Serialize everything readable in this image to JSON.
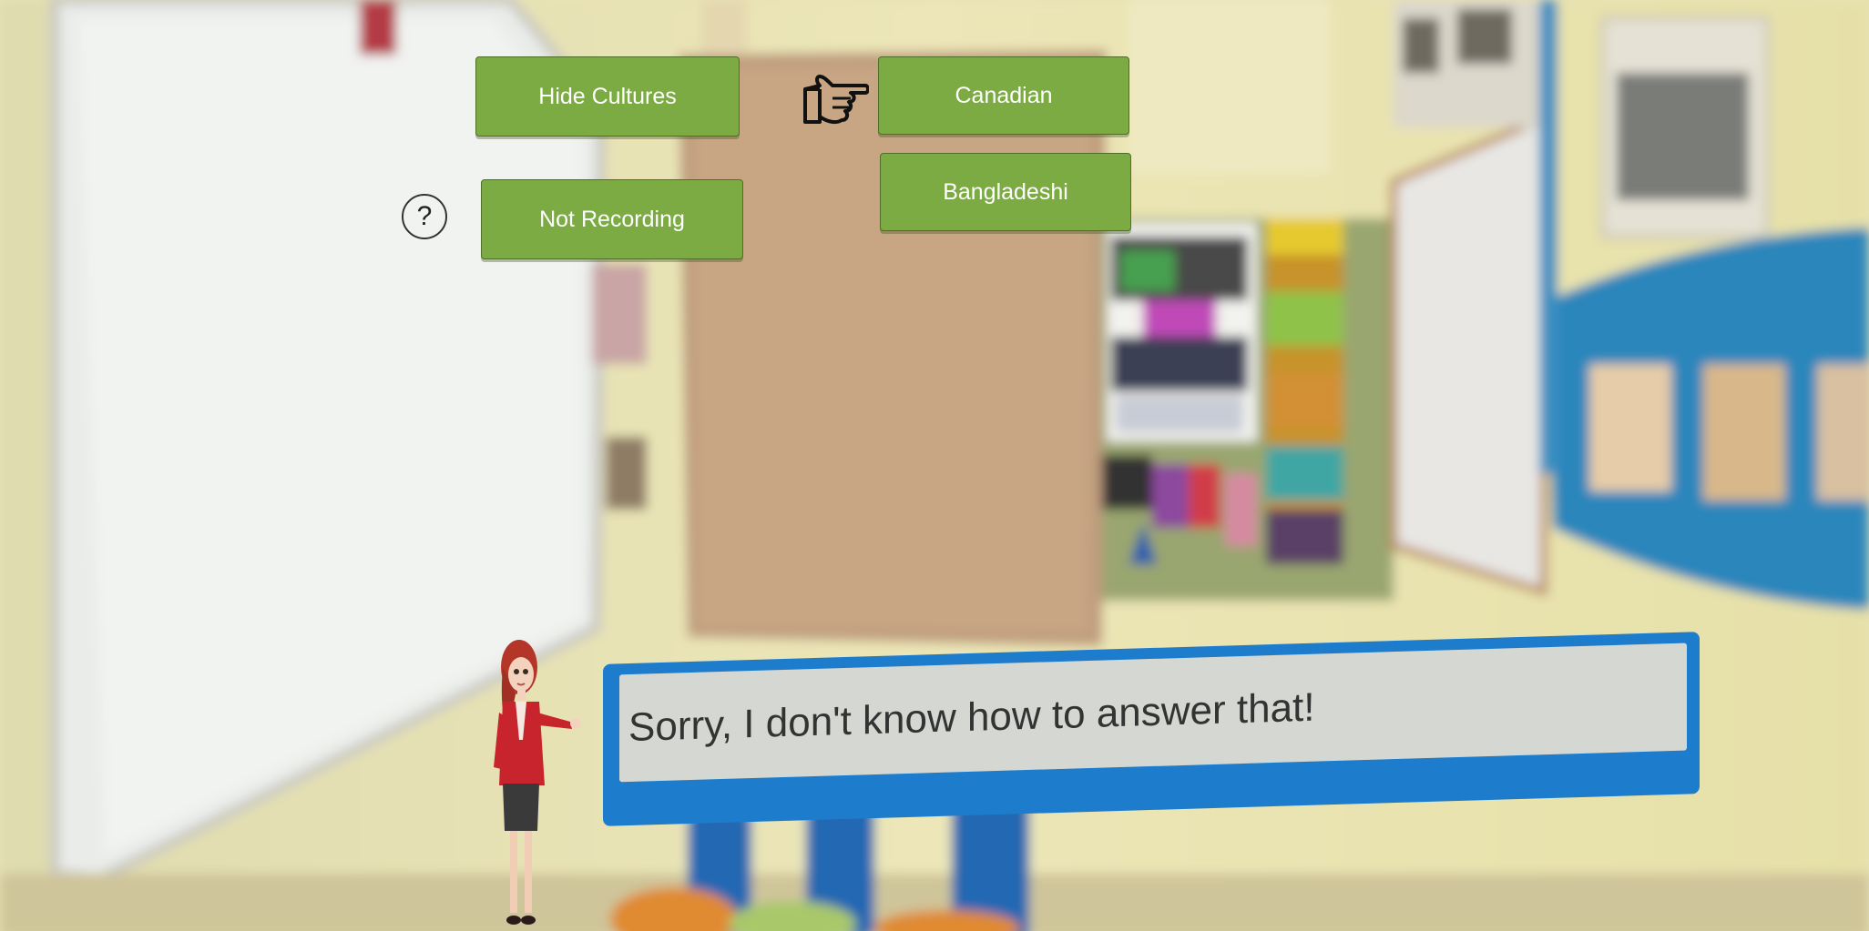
{
  "buttons": {
    "hide_cultures": "Hide Cultures",
    "not_recording": "Not Recording",
    "canadian": "Canadian",
    "bangladeshi": "Bangladeshi"
  },
  "help": {
    "symbol": "?"
  },
  "speech": {
    "text": "Sorry, I don't know how to answer that!"
  },
  "icons": {
    "pointer": "pointing-hand-icon",
    "help": "question-mark-icon"
  },
  "colors": {
    "button_green": "#7cab43",
    "speech_blue": "#1e7ccc",
    "speech_bg": "#d5d8d2"
  }
}
